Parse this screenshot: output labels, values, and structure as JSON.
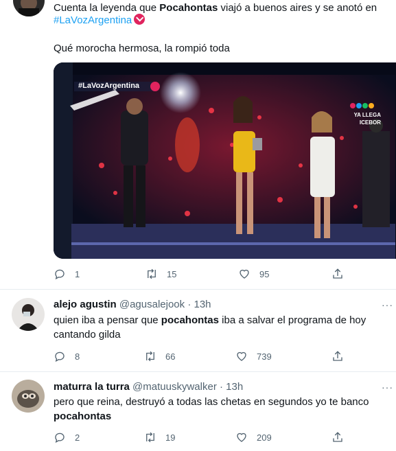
{
  "main_tweet": {
    "line1_pre": "Cuenta la leyenda que ",
    "line1_bold": "Pocahontas",
    "line1_post": " viajó a buenos aires y se anotó en",
    "hashtag": "#LaVozArgentina",
    "line2": "Qué morocha hermosa, la rompió toda",
    "media": {
      "overlay_tag": "#LaVozArgentina",
      "corner_text_1": "YA LLEGA",
      "corner_text_2": "ICEBOR"
    },
    "actions": {
      "replies": "1",
      "retweets": "15",
      "likes": "95"
    }
  },
  "replies": [
    {
      "name": "alejo agustin",
      "handle": "@agusalejook",
      "dot": "·",
      "time": "13h",
      "line1_pre": "quien iba a pensar que ",
      "line1_bold": "pocahontas",
      "line1_post": " iba a salvar el programa de hoy",
      "line2": "cantando gilda",
      "actions": {
        "replies": "8",
        "retweets": "66",
        "likes": "739"
      },
      "more": "···"
    },
    {
      "name": "maturra la turra",
      "handle": "@matuuskywalker",
      "dot": "·",
      "time": "13h",
      "line1": "pero que reina, destruyó a todas las chetas en segundos yo te banco",
      "line2_bold": "pocahontas",
      "actions": {
        "replies": "2",
        "retweets": "19",
        "likes": "209"
      },
      "more": "···"
    }
  ],
  "colors": {
    "accent": "#1da1f2",
    "muted": "#536471",
    "divider": "#e6ecf0",
    "badge": "#e0245e"
  },
  "icons": [
    "reply-icon",
    "retweet-icon",
    "like-icon",
    "share-icon",
    "more-icon"
  ]
}
